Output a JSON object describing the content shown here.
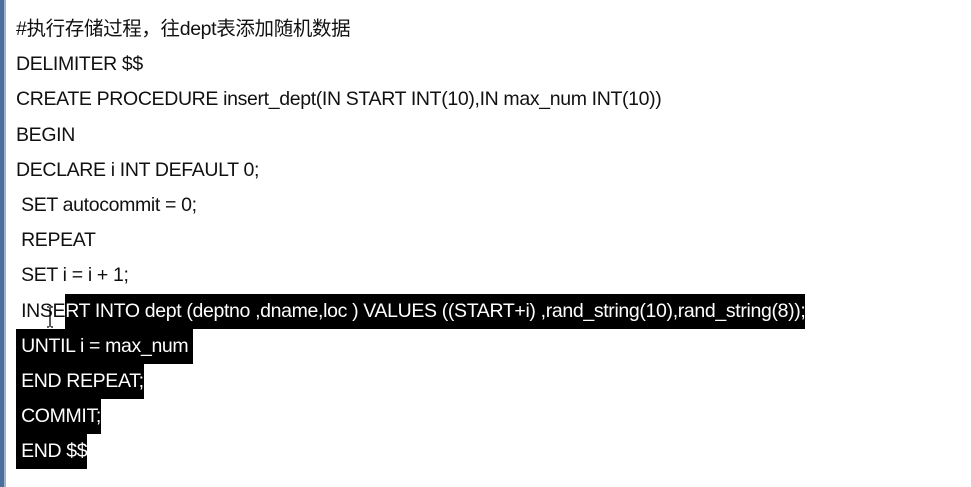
{
  "editor": {
    "lines": [
      "#执行存储过程，往dept表添加随机数据",
      "DELIMITER $$",
      "CREATE PROCEDURE insert_dept(IN START INT(10),IN max_num INT(10))",
      "BEGIN",
      "DECLARE i INT DEFAULT 0;",
      " SET autocommit = 0;",
      " REPEAT",
      " SET i = i + 1;"
    ],
    "partial_line": {
      "unselected": " INSE",
      "selected": "RT INTO dept (deptno ,dname,loc ) VALUES ((START+i) ,rand_string(10),rand_string(8));"
    },
    "selected_lines": [
      " UNTIL i = max_num ",
      " END REPEAT;",
      " COMMIT;",
      " END $$"
    ]
  },
  "colors": {
    "text": "#111111",
    "selection_bg": "#000000",
    "selection_text": "#ffffff",
    "border": "#4a6f9a"
  },
  "icons": {
    "cursor": "text-ibeam-cursor-icon"
  }
}
